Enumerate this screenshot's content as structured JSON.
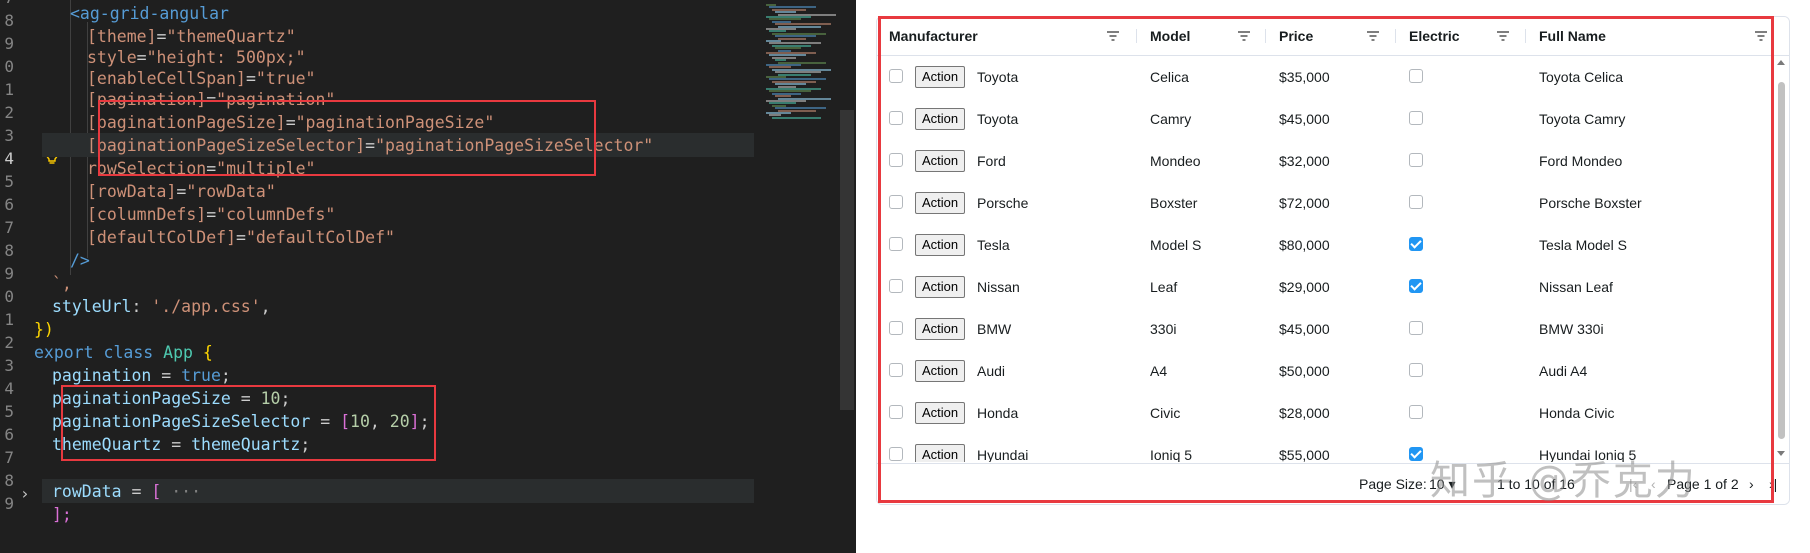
{
  "editor": {
    "line_numbers": [
      "7",
      "8",
      "9",
      "0",
      "1",
      "2",
      "3",
      "4",
      "5",
      "6",
      "7",
      "8",
      "9",
      "0",
      "1",
      "2",
      "3",
      "4",
      "5",
      "6",
      "7",
      "8",
      "9"
    ],
    "active_line": "4",
    "code": {
      "l1_tag": "<ag-grid-angular",
      "l2_attr": "[theme]",
      "l2_val": "\"themeQuartz\"",
      "l3_attr": "style",
      "l3_val": "\"height: 500px;\"",
      "l4_attr": "[enableCellSpan]",
      "l4_val": "\"true\"",
      "l5_attr": "[pagination]",
      "l5_val": "\"pagination\"",
      "l6_attr": "[paginationPageSize]",
      "l6_val": "\"paginationPageSize\"",
      "l7_attr": "[paginationPageSizeSelector]",
      "l7_val": "\"paginationPageSizeSelector\"",
      "l8_attr": "rowSelection",
      "l8_val": "\"multiple\"",
      "l9_attr": "[rowData]",
      "l9_val": "\"rowData\"",
      "l10_attr": "[columnDefs]",
      "l10_val": "\"columnDefs\"",
      "l11_attr": "[defaultColDef]",
      "l11_val": "\"defaultColDef\"",
      "l12": "/>",
      "l13": "`,",
      "l14_prop": "styleUrl",
      "l14_val": "'./app.css'",
      "l15": "})",
      "l16_kw1": "export",
      "l16_kw2": "class",
      "l16_cls": "App",
      "l16_br": "{",
      "l17_prop": "pagination",
      "l17_val": "true",
      "l18_prop": "paginationPageSize",
      "l18_val": "10",
      "l19_prop": "paginationPageSizeSelector",
      "l19_n1": "10",
      "l19_n2": "20",
      "l20_prop": "themeQuartz",
      "l20_val": "themeQuartz",
      "l21_prop": "rowData",
      "l21_more": "···",
      "l22": "];"
    }
  },
  "grid": {
    "columns": [
      "Manufacturer",
      "Model",
      "Price",
      "Electric",
      "Full Name"
    ],
    "action_label": "Action",
    "rows": [
      {
        "make": "Toyota",
        "model": "Celica",
        "price": "$35,000",
        "electric": false,
        "full": "Toyota Celica"
      },
      {
        "make": "Toyota",
        "model": "Camry",
        "price": "$45,000",
        "electric": false,
        "full": "Toyota Camry"
      },
      {
        "make": "Ford",
        "model": "Mondeo",
        "price": "$32,000",
        "electric": false,
        "full": "Ford Mondeo"
      },
      {
        "make": "Porsche",
        "model": "Boxster",
        "price": "$72,000",
        "electric": false,
        "full": "Porsche Boxster"
      },
      {
        "make": "Tesla",
        "model": "Model S",
        "price": "$80,000",
        "electric": true,
        "full": "Tesla Model S"
      },
      {
        "make": "Nissan",
        "model": "Leaf",
        "price": "$29,000",
        "electric": true,
        "full": "Nissan Leaf"
      },
      {
        "make": "BMW",
        "model": "330i",
        "price": "$45,000",
        "electric": false,
        "full": "BMW 330i"
      },
      {
        "make": "Audi",
        "model": "A4",
        "price": "$50,000",
        "electric": false,
        "full": "Audi A4"
      },
      {
        "make": "Honda",
        "model": "Civic",
        "price": "$28,000",
        "electric": false,
        "full": "Honda Civic"
      },
      {
        "make": "Hyundai",
        "model": "Ioniq 5",
        "price": "$55,000",
        "electric": true,
        "full": "Hyundai Ioniq 5"
      }
    ],
    "pager": {
      "page_size_label": "Page Size:",
      "page_size_value": "10",
      "range": "1 to 10 of 16",
      "page": "Page 1 of 2"
    }
  },
  "watermark": "知乎 @乔克力",
  "colors": {
    "highlight": "#e8393f",
    "checkbox_on": "#2196f3"
  }
}
